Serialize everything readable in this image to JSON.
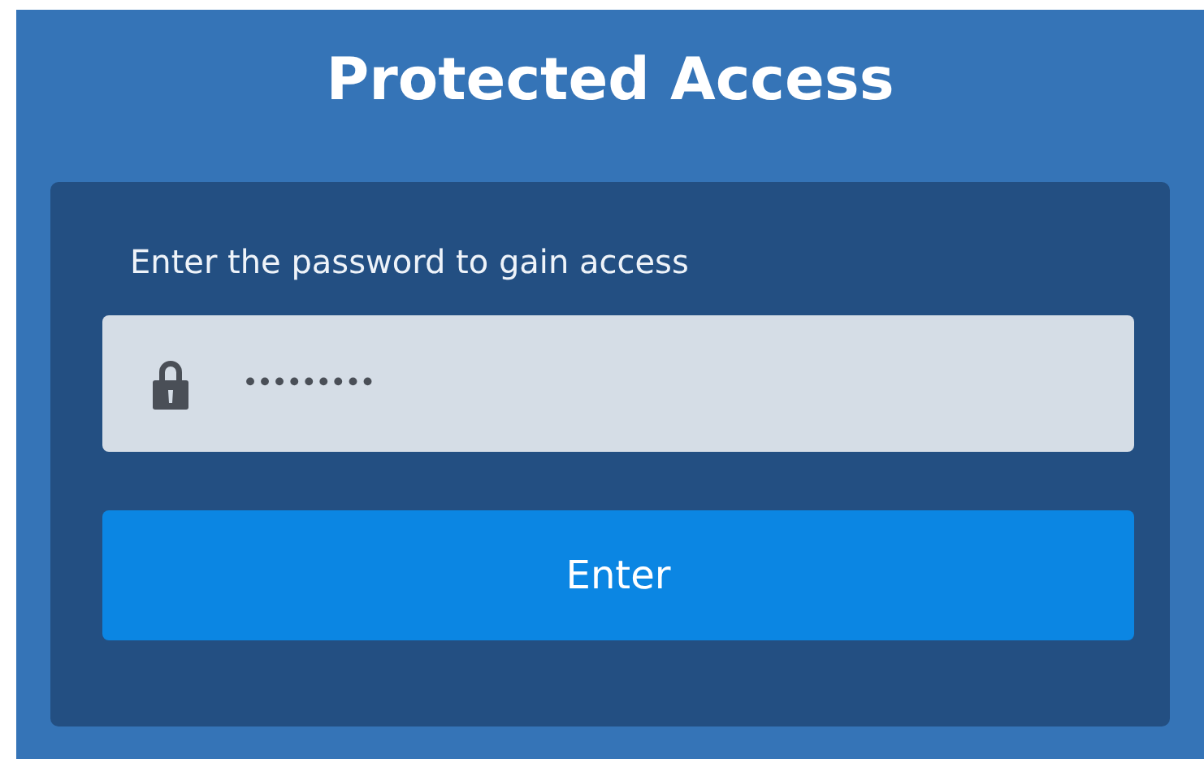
{
  "title": "Protected Access",
  "form": {
    "prompt": "Enter the password to gain access",
    "password": {
      "value": "•••••••••"
    },
    "button": "Enter"
  }
}
